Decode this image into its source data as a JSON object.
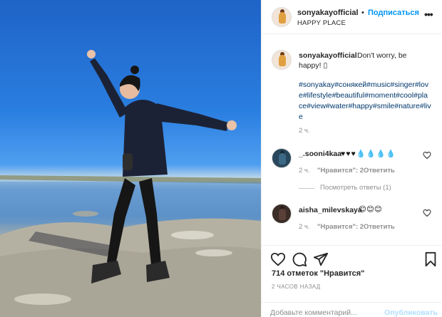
{
  "post": {
    "username": "sonyakayofficial",
    "follow_label": "Подписаться",
    "separator": "•",
    "location": "HAPPY PLACE",
    "more_label": "•••"
  },
  "caption": {
    "username": "sonyakayofficial",
    "text": "Don't worry, be",
    "text_line2": "happy! ▯",
    "hashtags": "#sonyakay#сонякей#music#singer#love#lifestyle#beautiful#moment#cool#place#view#water#happy#smile#nature#live",
    "time": "2 ч."
  },
  "comments": [
    {
      "username": "_.sooni4kaa",
      "text": "♥♥♥💧💧💧💧",
      "time": "2 ч.",
      "likes": "\"Нравится\": 2",
      "reply": "Ответить",
      "view_replies": "Посмотреть ответы (1)"
    },
    {
      "username": "aisha_milevskaya",
      "text": "😊😊😊",
      "time": "2 ч.",
      "likes": "\"Нравится\": 2",
      "reply": "Ответить"
    }
  ],
  "likes_text": "714 отметок \"Нравится\"",
  "posted_time": "2 ЧАСОВ НАЗАД",
  "add_comment": {
    "placeholder": "Добавьте комментарий...",
    "publish_label": "Опубликовать"
  },
  "icons": {
    "like": "heart-icon",
    "comment": "comment-icon",
    "share": "share-icon",
    "save": "bookmark-icon",
    "more": "more-icon"
  },
  "colors": {
    "link": "#0095f6",
    "hashtag": "#00376b",
    "muted": "#8e8e8e",
    "publish_disabled": "#b2dffc"
  }
}
